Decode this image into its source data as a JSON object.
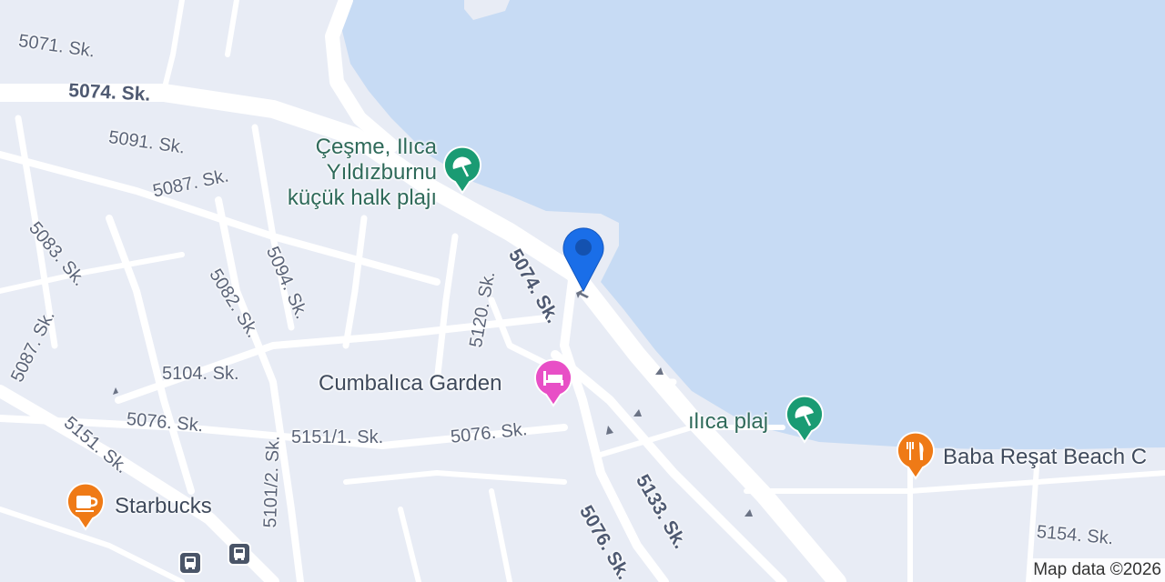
{
  "map": {
    "attribution": "Map data ©2026",
    "colors": {
      "water": "#c7dbf4",
      "land": "#e8ecf5",
      "road": "#ffffff",
      "beach_pin": "#1a9b73",
      "hotel_pin": "#e84fc6",
      "food_pin": "#ef7a16",
      "location_pin": "#1a6ee8"
    }
  },
  "streets": [
    "5071. Sk.",
    "5074. Sk.",
    "5091. Sk.",
    "5087. Sk.",
    "5083. Sk.",
    "5082. Sk.",
    "5094. Sk.",
    "5120. Sk.",
    "5074. Sk.",
    "5087. Sk.",
    "5104. Sk.",
    "5076. Sk.",
    "5151. Sk.",
    "5101/2. Sk.",
    "5151/1. Sk.",
    "5076. Sk.",
    "5133. Sk.",
    "5076. Sk.",
    "5154. Sk."
  ],
  "pois": [
    {
      "name_lines": [
        "Çeşme, Ilıca",
        "Yıldızburnu",
        "küçük halk plajı"
      ],
      "icon": "beach-umbrella-icon"
    },
    {
      "name_lines": [
        "Cumbalıca Garden"
      ],
      "icon": "bed-icon"
    },
    {
      "name_lines": [
        "ılıca plaj"
      ],
      "icon": "beach-umbrella-icon"
    },
    {
      "name_lines": [
        "Baba Reşat Beach C"
      ],
      "icon": "fork-knife-icon"
    },
    {
      "name_lines": [
        "Starbucks"
      ],
      "icon": "coffee-cup-icon"
    }
  ],
  "transit": [
    {
      "icon": "bus-icon"
    },
    {
      "icon": "bus-icon"
    }
  ],
  "location_marker": {
    "icon": "location-pin-icon"
  }
}
